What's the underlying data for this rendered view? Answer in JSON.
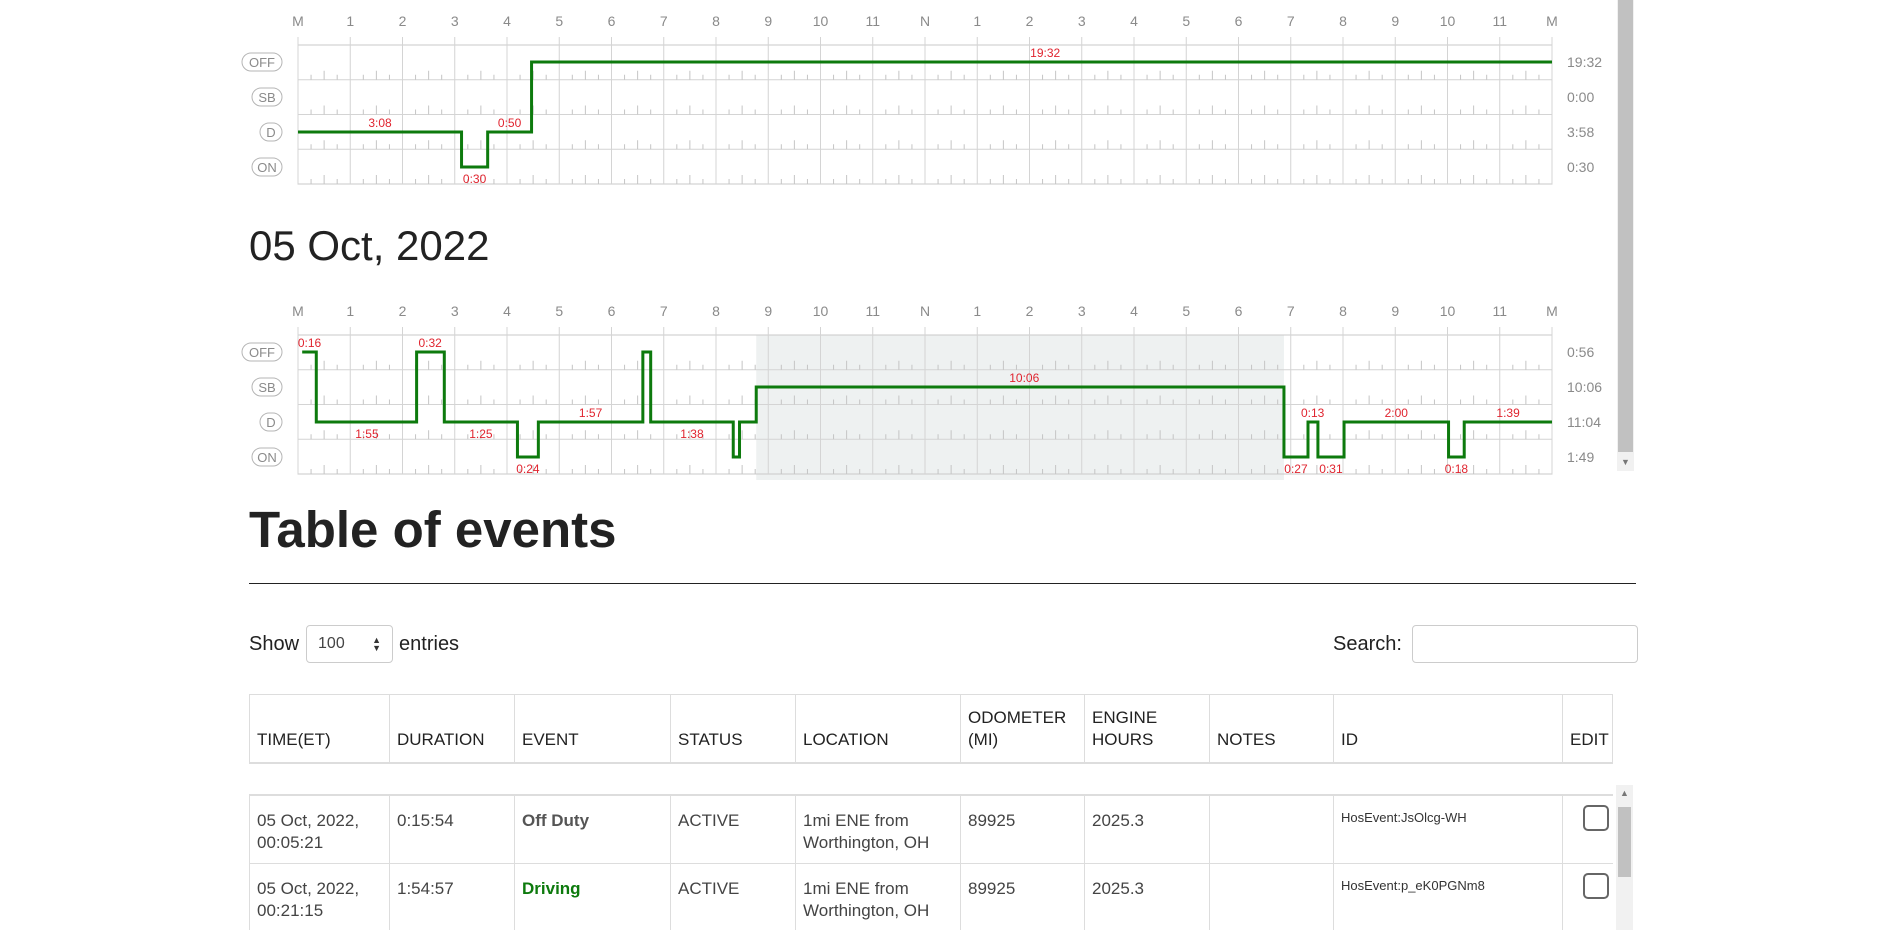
{
  "hour_labels": [
    "M",
    "1",
    "2",
    "3",
    "4",
    "5",
    "6",
    "7",
    "8",
    "9",
    "10",
    "11",
    "N",
    "1",
    "2",
    "3",
    "4",
    "5",
    "6",
    "7",
    "8",
    "9",
    "10",
    "11",
    "M"
  ],
  "status_rows": [
    "OFF",
    "SB",
    "D",
    "ON"
  ],
  "accent_color": "#0d7a0d",
  "annotation_color": "#e0242f",
  "logs": [
    {
      "date": "",
      "totals": [
        "19:32",
        "0:00",
        "3:58",
        "0:30"
      ],
      "segments": [
        {
          "status": "D",
          "start": 0.0,
          "end": 3.13
        },
        {
          "status": "ON",
          "start": 3.13,
          "end": 3.63
        },
        {
          "status": "D",
          "start": 3.63,
          "end": 4.47
        },
        {
          "status": "OFF",
          "start": 4.47,
          "end": 24.0
        }
      ],
      "labels": [
        {
          "text": "3:08",
          "row": "D",
          "at": 1.57,
          "pos": "above"
        },
        {
          "text": "0:30",
          "row": "ON",
          "at": 3.38,
          "pos": "below"
        },
        {
          "text": "0:50",
          "row": "D",
          "at": 4.05,
          "pos": "above"
        },
        {
          "text": "19:32",
          "row": "OFF",
          "at": 14.3,
          "pos": "above"
        }
      ],
      "shade": null
    },
    {
      "date": "05 Oct, 2022",
      "totals": [
        "0:56",
        "10:06",
        "11:04",
        "1:49"
      ],
      "segments": [
        {
          "status": "OFF",
          "start": 0.08,
          "end": 0.35
        },
        {
          "status": "D",
          "start": 0.35,
          "end": 2.27
        },
        {
          "status": "OFF",
          "start": 2.27,
          "end": 2.8
        },
        {
          "status": "D",
          "start": 2.8,
          "end": 4.2
        },
        {
          "status": "ON",
          "start": 4.2,
          "end": 4.6
        },
        {
          "status": "D",
          "start": 4.6,
          "end": 6.6
        },
        {
          "status": "OFF",
          "start": 6.6,
          "end": 6.75
        },
        {
          "status": "D",
          "start": 6.75,
          "end": 8.33
        },
        {
          "status": "ON",
          "start": 8.33,
          "end": 8.45
        },
        {
          "status": "D",
          "start": 8.45,
          "end": 8.77
        },
        {
          "status": "SB",
          "start": 8.77,
          "end": 18.87
        },
        {
          "status": "ON",
          "start": 18.87,
          "end": 19.33
        },
        {
          "status": "D",
          "start": 19.33,
          "end": 19.52
        },
        {
          "status": "ON",
          "start": 19.52,
          "end": 20.02
        },
        {
          "status": "D",
          "start": 20.02,
          "end": 22.02
        },
        {
          "status": "ON",
          "start": 22.02,
          "end": 22.32
        },
        {
          "status": "D",
          "start": 22.32,
          "end": 24.0
        }
      ],
      "labels": [
        {
          "text": "0:16",
          "row": "OFF",
          "at": 0.22,
          "pos": "above"
        },
        {
          "text": "1:55",
          "row": "D",
          "at": 1.32,
          "pos": "below"
        },
        {
          "text": "0:32",
          "row": "OFF",
          "at": 2.53,
          "pos": "above"
        },
        {
          "text": "1:25",
          "row": "D",
          "at": 3.5,
          "pos": "below"
        },
        {
          "text": "0:24",
          "row": "ON",
          "at": 4.4,
          "pos": "below"
        },
        {
          "text": "1:57",
          "row": "D",
          "at": 5.6,
          "pos": "above"
        },
        {
          "text": "1:38",
          "row": "D",
          "at": 7.54,
          "pos": "below"
        },
        {
          "text": "10:06",
          "row": "SB",
          "at": 13.9,
          "pos": "above"
        },
        {
          "text": "0:27",
          "row": "ON",
          "at": 19.1,
          "pos": "below"
        },
        {
          "text": "0:13",
          "row": "D",
          "at": 19.42,
          "pos": "above"
        },
        {
          "text": "0:31",
          "row": "ON",
          "at": 19.77,
          "pos": "below"
        },
        {
          "text": "2:00",
          "row": "D",
          "at": 21.02,
          "pos": "above"
        },
        {
          "text": "0:18",
          "row": "ON",
          "at": 22.17,
          "pos": "below"
        },
        {
          "text": "1:39",
          "row": "D",
          "at": 23.16,
          "pos": "above"
        }
      ],
      "shade": {
        "start": 8.77,
        "end": 18.87
      }
    }
  ],
  "section_title": "Table of events",
  "length_menu": {
    "prefix": "Show",
    "value": "100",
    "suffix": "entries"
  },
  "search": {
    "label": "Search:",
    "value": ""
  },
  "columns": [
    "TIME(ET)",
    "DURATION",
    "EVENT",
    "STATUS",
    "LOCATION",
    "ODOMETER (MI)",
    "ENGINE HOURS",
    "NOTES",
    "ID",
    "EDIT"
  ],
  "rows": [
    {
      "time": "05 Oct, 2022, 00:05:21",
      "duration": "0:15:54",
      "event": "Off Duty",
      "event_color": "#555555",
      "status": "ACTIVE",
      "location": "1mi ENE from Worthington, OH",
      "odometer": "89925",
      "engine_hours": "2025.3",
      "notes": "",
      "id": "HosEvent:JsOlcg-WH"
    },
    {
      "time": "05 Oct, 2022, 00:21:15",
      "duration": "1:54:57",
      "event": "Driving",
      "event_color": "#0d7a0d",
      "status": "ACTIVE",
      "location": "1mi ENE from Worthington, OH",
      "odometer": "89925",
      "engine_hours": "2025.3",
      "notes": "",
      "id": "HosEvent:p_eK0PGNm8"
    }
  ]
}
